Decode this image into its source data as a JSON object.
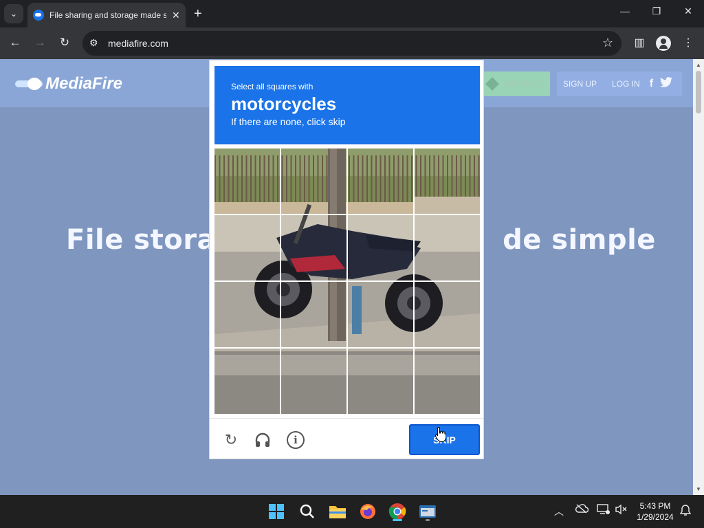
{
  "browser": {
    "tab_title": "File sharing and storage made simple",
    "url": "mediafire.com",
    "new_tab_label": "+",
    "tab_close": "✕"
  },
  "site": {
    "logo_text": "MediaFire",
    "upgrade_label": "UPGRADE",
    "signup_label": "SIGN UP",
    "login_label": "LOG IN",
    "facebook_glyph": "f",
    "twitter_icon": "twitter-icon",
    "hero_left": "File storag",
    "hero_right": "de simple"
  },
  "captcha": {
    "instruction": "Select all squares with",
    "target": "motorcycles",
    "hint": "If there are none, click skip",
    "skip_label": "SKIP",
    "refresh_icon": "refresh-icon",
    "audio_icon": "headphones-icon",
    "info_icon": "info-icon",
    "grid_rows": 4,
    "grid_cols": 4,
    "accent_color": "#1a73e8"
  },
  "taskbar": {
    "time": "5:43 PM",
    "date": "1/29/2024"
  }
}
